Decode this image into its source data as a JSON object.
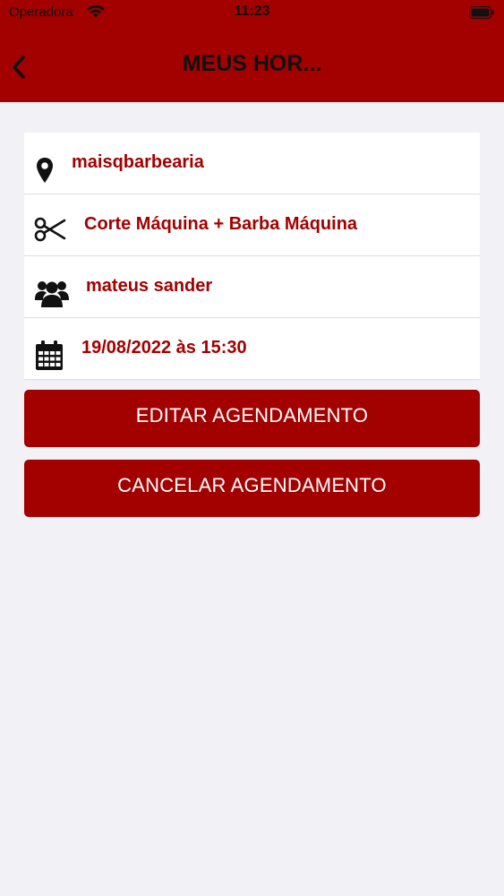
{
  "status_bar": {
    "carrier": "Operadora",
    "time": "11:23"
  },
  "nav": {
    "title": "MEUS HOR..."
  },
  "appointment": {
    "shop": "maisqbarbearia",
    "service": "Corte Máquina + Barba Máquina",
    "professional": "mateus sander",
    "datetime": "19/08/2022 às 15:30"
  },
  "actions": {
    "edit_label": "EDITAR AGENDAMENTO",
    "cancel_label": "CANCELAR AGENDAMENTO"
  },
  "icons": [
    "wifi-icon",
    "battery-icon",
    "back-chevron-icon",
    "location-pin-icon",
    "scissors-icon",
    "users-icon",
    "calendar-icon"
  ],
  "colors": {
    "brand": "#a30000",
    "background": "#f2f1f6",
    "card": "#ffffff",
    "text_on_brand": "#ffffff"
  }
}
